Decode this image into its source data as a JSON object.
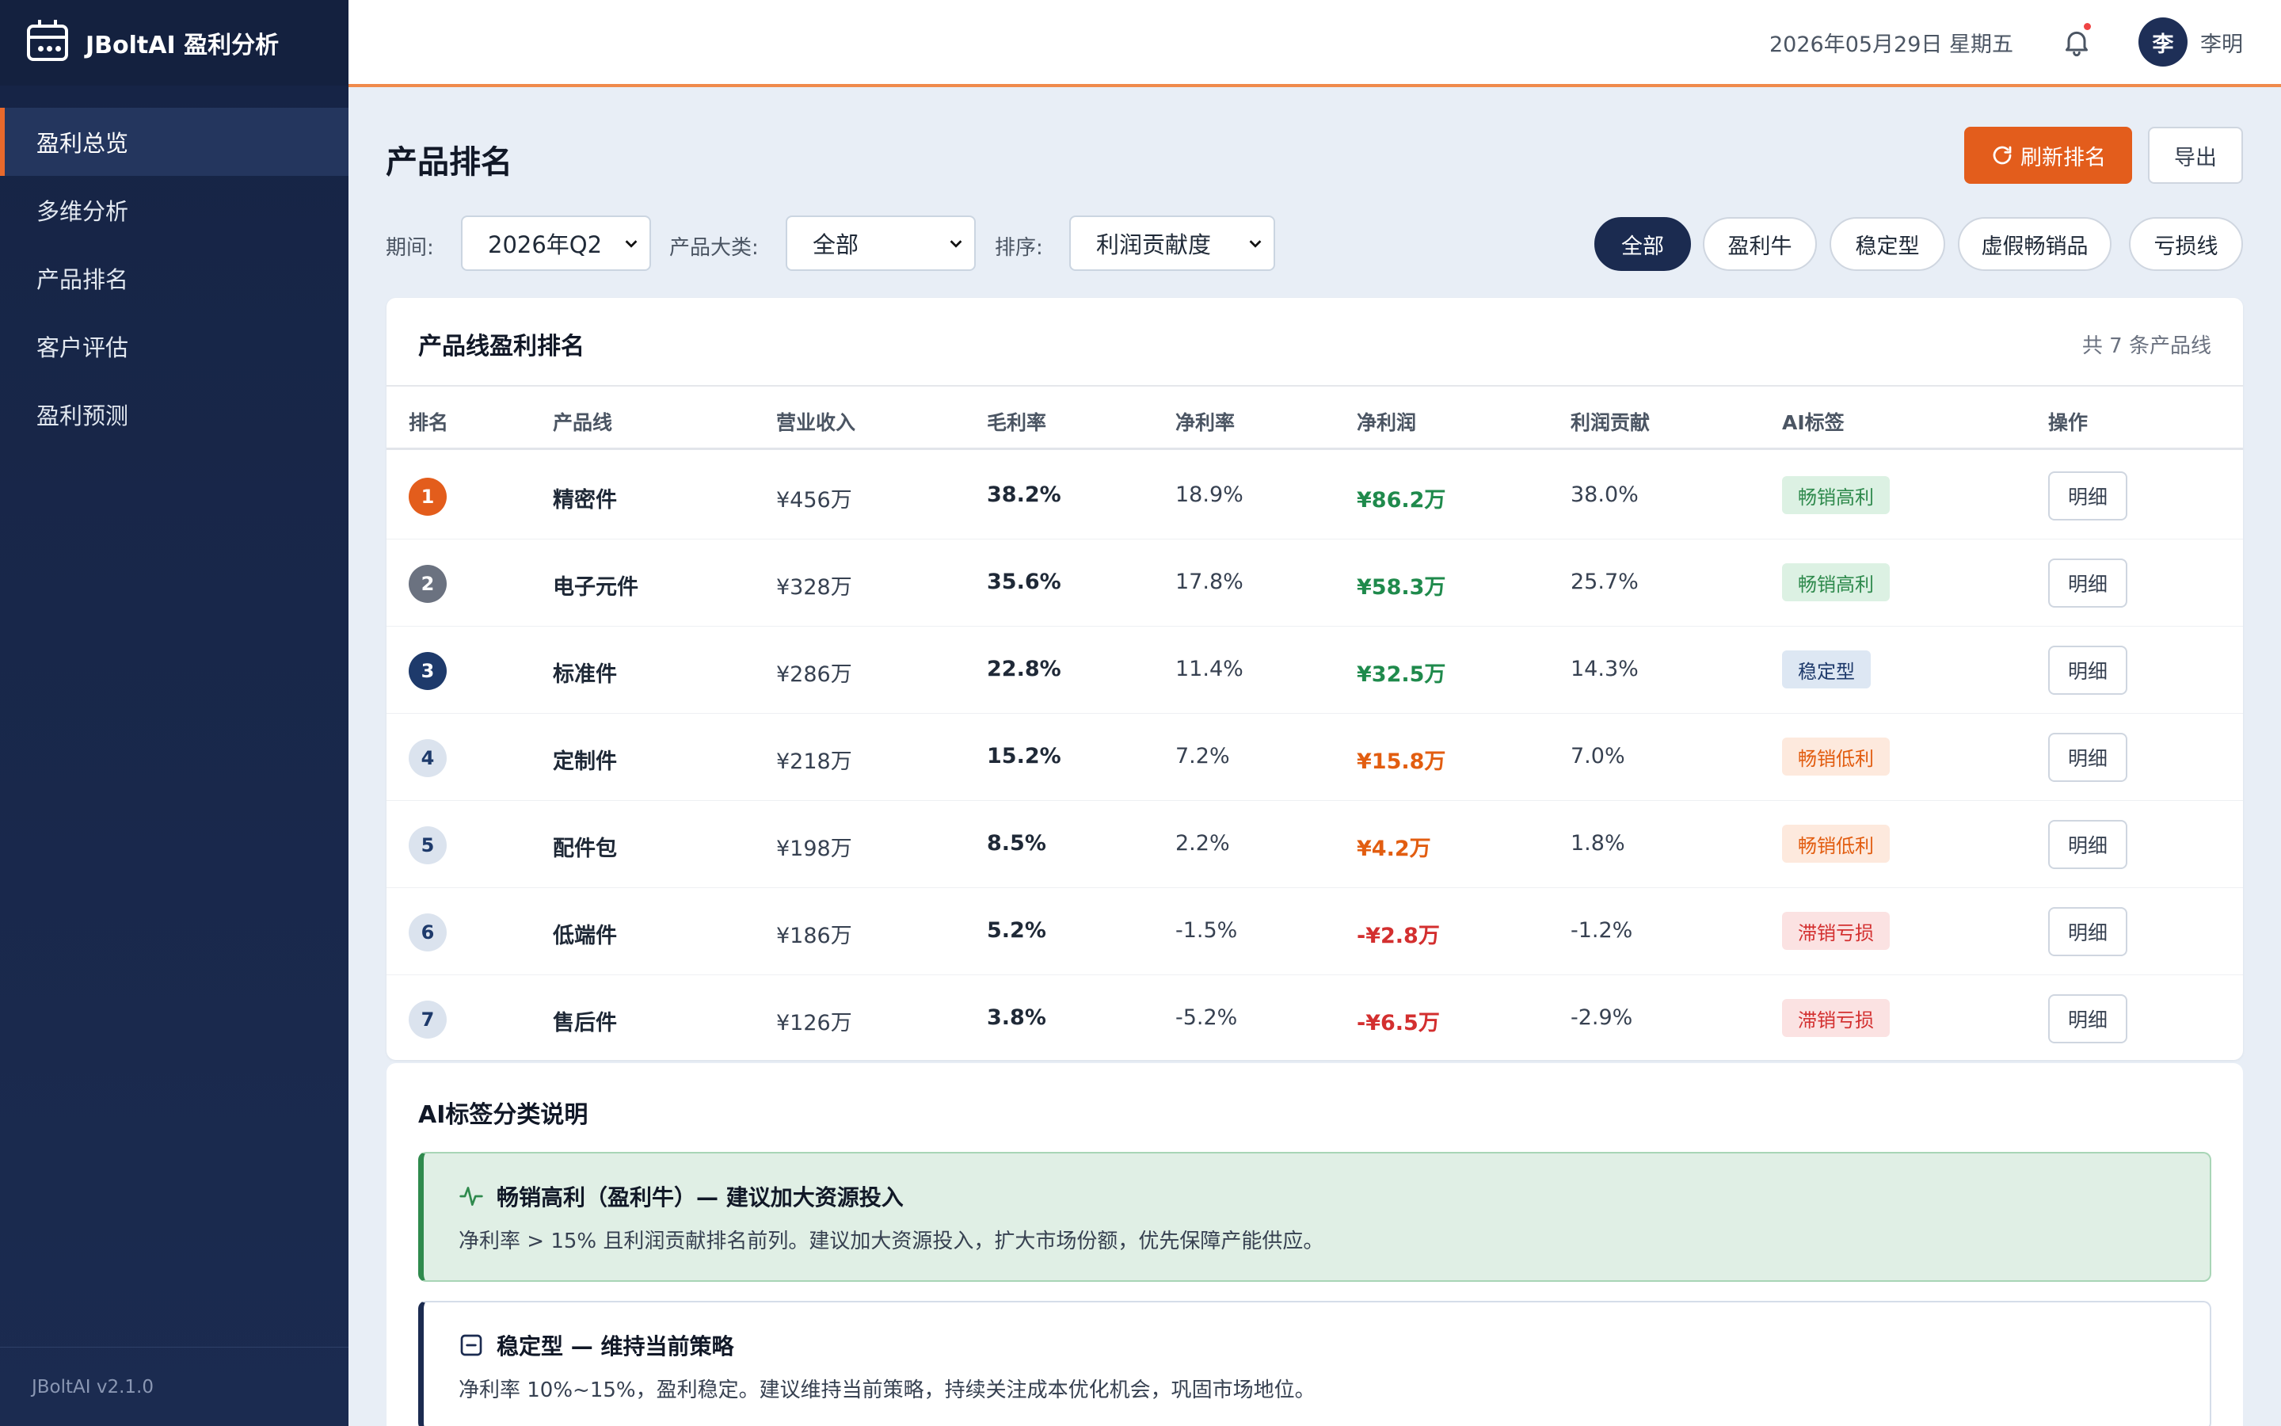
{
  "app": {
    "title": "JBoltAI 盈利分析",
    "version": "JBoltAI v2.1.0"
  },
  "sidebar": {
    "items": [
      {
        "label": "盈利总览",
        "active": true
      },
      {
        "label": "多维分析"
      },
      {
        "label": "产品排名"
      },
      {
        "label": "客户评估"
      },
      {
        "label": "盈利预测"
      }
    ]
  },
  "header": {
    "date": "2026年05月29日 星期五",
    "avatar_char": "李",
    "username": "李明"
  },
  "page": {
    "title": "产品排名",
    "refresh_label": "刷新排名",
    "export_label": "导出"
  },
  "filters": {
    "period_label": "期间:",
    "period_value": "2026年Q2",
    "category_label": "产品大类:",
    "category_value": "全部",
    "sort_label": "排序:",
    "sort_value": "利润贡献度"
  },
  "pills": [
    "全部",
    "盈利牛",
    "稳定型",
    "虚假畅销品",
    "亏损线"
  ],
  "table": {
    "title": "产品线盈利排名",
    "count": "共 7 条产品线",
    "columns": [
      "排名",
      "产品线",
      "营业收入",
      "毛利率",
      "净利率",
      "净利润",
      "利润贡献",
      "AI标签",
      "操作"
    ],
    "action_label": "明细",
    "rows": [
      {
        "rank": "1",
        "name": "精密件",
        "revenue": "¥456万",
        "gross": "38.2%",
        "net_rate": "18.9%",
        "net_profit": "¥86.2万",
        "contribution": "38.0%",
        "tag": "畅销高利",
        "tag_type": "green",
        "profit_color": "green"
      },
      {
        "rank": "2",
        "name": "电子元件",
        "revenue": "¥328万",
        "gross": "35.6%",
        "net_rate": "17.8%",
        "net_profit": "¥58.3万",
        "contribution": "25.7%",
        "tag": "畅销高利",
        "tag_type": "green",
        "profit_color": "green"
      },
      {
        "rank": "3",
        "name": "标准件",
        "revenue": "¥286万",
        "gross": "22.8%",
        "net_rate": "11.4%",
        "net_profit": "¥32.5万",
        "contribution": "14.3%",
        "tag": "稳定型",
        "tag_type": "blue",
        "profit_color": "green"
      },
      {
        "rank": "4",
        "name": "定制件",
        "revenue": "¥218万",
        "gross": "15.2%",
        "net_rate": "7.2%",
        "net_profit": "¥15.8万",
        "contribution": "7.0%",
        "tag": "畅销低利",
        "tag_type": "orange",
        "profit_color": "orange"
      },
      {
        "rank": "5",
        "name": "配件包",
        "revenue": "¥198万",
        "gross": "8.5%",
        "net_rate": "2.2%",
        "net_profit": "¥4.2万",
        "contribution": "1.8%",
        "tag": "畅销低利",
        "tag_type": "orange",
        "profit_color": "orange"
      },
      {
        "rank": "6",
        "name": "低端件",
        "revenue": "¥186万",
        "gross": "5.2%",
        "net_rate": "-1.5%",
        "net_profit": "-¥2.8万",
        "contribution": "-1.2%",
        "tag": "滞销亏损",
        "tag_type": "red",
        "profit_color": "red"
      },
      {
        "rank": "7",
        "name": "售后件",
        "revenue": "¥126万",
        "gross": "3.8%",
        "net_rate": "-5.2%",
        "net_profit": "-¥6.5万",
        "contribution": "-2.9%",
        "tag": "滞销亏损",
        "tag_type": "red",
        "profit_color": "red"
      }
    ]
  },
  "legend": {
    "title": "AI标签分类说明",
    "items": [
      {
        "heading": "畅销高利（盈利牛）— 建议加大资源投入",
        "text": "净利率 > 15% 且利润贡献排名前列。建议加大资源投入，扩大市场份额，优先保障产能供应。",
        "icon": "pulse-icon"
      },
      {
        "heading": "稳定型 — 维持当前策略",
        "text": "净利率 10%~15%，盈利稳定。建议维持当前策略，持续关注成本优化机会，巩固市场地位。",
        "icon": "minus-square-icon"
      }
    ]
  },
  "colors": {
    "accent": "#e35d1c",
    "sidebar": "#1b2b50",
    "green": "#1f8a4c",
    "orange": "#e25d10",
    "red": "#d32f2f"
  }
}
